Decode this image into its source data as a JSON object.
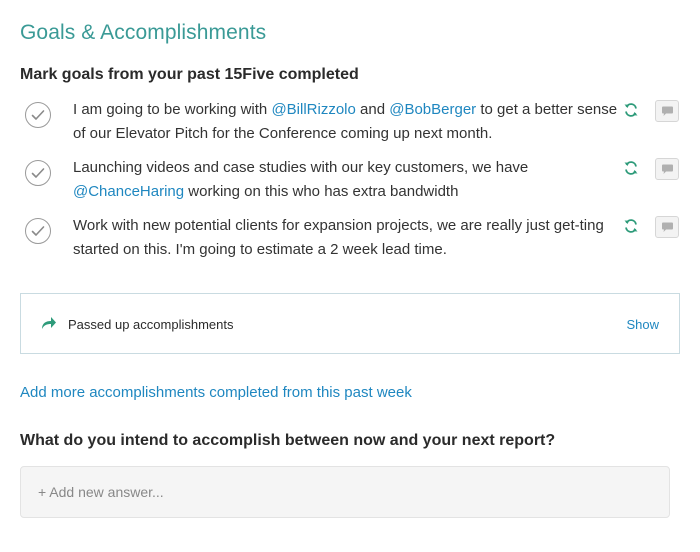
{
  "section_title": "Goals & Accomplishments",
  "mark_goals_heading": "Mark goals from your past 15Five completed",
  "goals": [
    {
      "segments": [
        {
          "text": "I am going to be working with ",
          "mention": false
        },
        {
          "text": "@BillRizzolo",
          "mention": true
        },
        {
          "text": " and ",
          "mention": false
        },
        {
          "text": "@BobBerger",
          "mention": true
        },
        {
          "text": " to get a better sense of our Elevator Pitch for the Conference coming up next month.",
          "mention": false
        }
      ]
    },
    {
      "segments": [
        {
          "text": "Launching videos and case studies with our key customers, we have ",
          "mention": false
        },
        {
          "text": "@ChanceHaring",
          "mention": true
        },
        {
          "text": " working on this who has extra bandwidth",
          "mention": false
        }
      ]
    },
    {
      "segments": [
        {
          "text": "Work with new potential clients for expansion projects, we are really just get-ting started on this. I'm going to estimate a 2 week lead time.",
          "mention": false
        }
      ]
    }
  ],
  "icons": {
    "check": "check-circle-icon",
    "repeat": "repeat-icon",
    "comment": "comment-icon",
    "share": "share-arrow-icon"
  },
  "passed_up": {
    "label": "Passed up accomplishments",
    "toggle_label": "Show"
  },
  "add_more_link": "Add more accomplishments completed from this past week",
  "intend_question": "What do you intend to accomplish between now and your next report?",
  "answer_placeholder": "+ Add new answer...",
  "colors": {
    "accent_teal": "#3a9a96",
    "link_blue": "#1f87c0",
    "repeat_green": "#2e9b7a"
  }
}
